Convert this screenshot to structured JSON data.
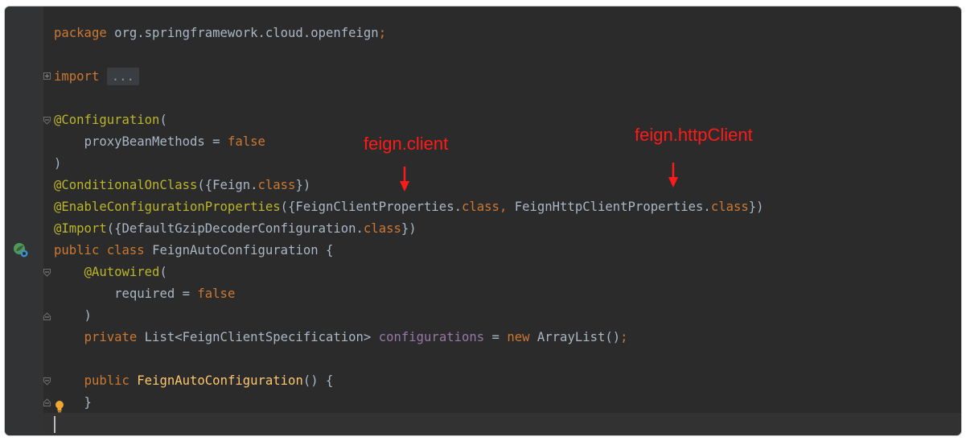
{
  "editor": {
    "lines": {
      "l1": {
        "kw": "package",
        "text": " org.springframework.cloud.openfeign",
        "semi": ";"
      },
      "l2": {
        "kw": "import",
        "fold": "..."
      },
      "l3": {
        "ann": "@Configuration",
        "rest": "("
      },
      "l4": {
        "indent": "    ",
        "name": "proxyBeanMethods = ",
        "val": "false"
      },
      "l5": {
        "text": ")"
      },
      "l6": {
        "ann": "@ConditionalOnClass",
        "a": "({Feign.",
        "kw": "class",
        "b": "})"
      },
      "l7": {
        "ann": "@EnableConfigurationProperties",
        "a": "({FeignClientProperties.",
        "kw1": "class",
        "c": ",",
        "b": " FeignHttpClientProperties.",
        "kw2": "class",
        "d": "})"
      },
      "l8": {
        "ann": "@Import",
        "a": "({DefaultGzipDecoderConfiguration.",
        "kw": "class",
        "b": "})"
      },
      "l9": {
        "kw1": "public",
        "kw2": "class",
        "text": " FeignAutoConfiguration {"
      },
      "l10": {
        "indent": "    ",
        "ann": "@Autowired",
        "rest": "("
      },
      "l11": {
        "indent": "        ",
        "name": "required = ",
        "val": "false"
      },
      "l12": {
        "text": "    )"
      },
      "l13": {
        "indent": "    ",
        "kw1": "private",
        "type": " List<FeignClientSpecification> ",
        "field": "configurations",
        "eq": " = ",
        "kw2": "new",
        "rest": " ArrayList()",
        "semi": ";"
      },
      "l14": {
        "indent": "    ",
        "kw": "public",
        "fn": "FeignAutoConfiguration",
        "rest": "() {"
      },
      "l15": {
        "text": "    }"
      }
    }
  },
  "annotations": {
    "client": "feign.client",
    "http_client": "feign.httpClient"
  },
  "colors": {
    "annotation_red": "#ff1a1a",
    "keyword": "#cc7832",
    "annotation": "#bbb529",
    "field": "#9876aa",
    "function": "#ffc66d",
    "default_text": "#a9b7c6"
  },
  "icons": {
    "bean_gutter": "spring-bean-icon",
    "bulb": "intention-bulb-icon"
  }
}
